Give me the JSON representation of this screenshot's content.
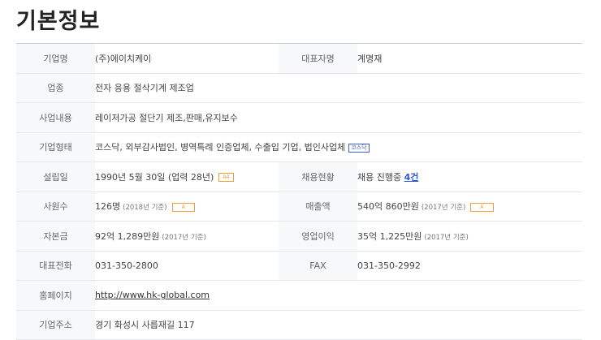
{
  "title": "기본정보",
  "rows": {
    "company_name": {
      "label": "기업명",
      "value": "(주)에이치케이"
    },
    "ceo": {
      "label": "대표자명",
      "value": "계명재"
    },
    "industry": {
      "label": "업종",
      "value": "전자 응용 절삭기계 제조업"
    },
    "business": {
      "label": "사업내용",
      "value": "레이저가공 절단기 제조,판매,유지보수"
    },
    "company_type": {
      "label": "기업형태",
      "value": "코스닥, 외부감사법인, 병역특례 인증업체, 수출입 기업, 법인사업체",
      "badge": "코스닥"
    },
    "founded": {
      "label": "설립일",
      "value": "1990년 5월 30일 (업력 28년)",
      "badge": "AA"
    },
    "hiring": {
      "label": "채용현황",
      "value_prefix": "채용 진행중",
      "count": "4건"
    },
    "employees": {
      "label": "사원수",
      "value": "126명",
      "note": "(2018년 기준)",
      "badge": "A"
    },
    "revenue": {
      "label": "매출액",
      "value": "540억 860만원",
      "note": "(2017년 기준)",
      "badge": "A"
    },
    "capital": {
      "label": "자본금",
      "value": "92억 1,289만원",
      "note": "(2017년 기준)"
    },
    "operating_profit": {
      "label": "영업이익",
      "value": "35억 1,225만원",
      "note": "(2017년 기준)"
    },
    "phone": {
      "label": "대표전화",
      "value": "031-350-2800"
    },
    "fax": {
      "label": "FAX",
      "value": "031-350-2992"
    },
    "homepage": {
      "label": "홈페이지",
      "value": "http://www.hk-global.com"
    },
    "address": {
      "label": "기업주소",
      "value": "경기 화성시 사릅재길 117"
    }
  }
}
